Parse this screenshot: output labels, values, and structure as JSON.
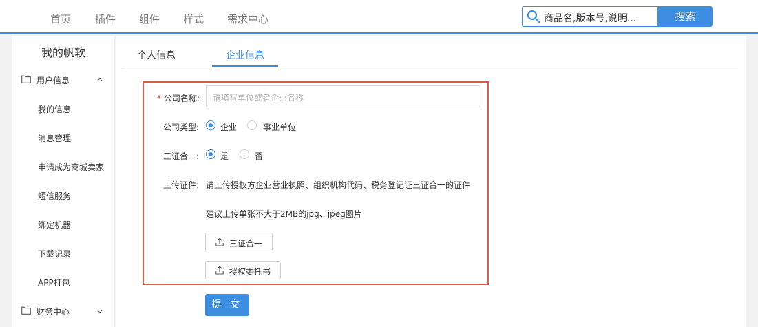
{
  "nav": {
    "items": [
      "首页",
      "插件",
      "组件",
      "样式",
      "需求中心"
    ],
    "search_placeholder": "商品名,版本号,说明...",
    "search_button": "搜索"
  },
  "sidebar": {
    "title": "我的帆软",
    "groups": [
      {
        "label": "用户信息",
        "expanded": true,
        "items": [
          "我的信息",
          "消息管理",
          "申请成为商城卖家",
          "短信服务",
          "绑定机器",
          "下载记录",
          "APP打包"
        ]
      },
      {
        "label": "财务中心",
        "expanded": false,
        "items": []
      }
    ]
  },
  "tabs": [
    {
      "label": "个人信息",
      "active": false
    },
    {
      "label": "企业信息",
      "active": true
    }
  ],
  "form": {
    "company_name_label": "公司名称:",
    "company_name_placeholder": "请填写单位或者企业名称",
    "company_type_label": "公司类型:",
    "company_type_options": [
      "企业",
      "事业单位"
    ],
    "company_type_selected": "企业",
    "three_in_one_label": "三证合一:",
    "three_in_one_options": [
      "是",
      "否"
    ],
    "three_in_one_selected": "是",
    "upload_label": "上传证件:",
    "upload_hint": "请上传授权方企业营业执照、组织机构代码、税务登记证三证合一的证件",
    "upload_size_hint": "建议上传单张不大于2MB的jpg、jpeg图片",
    "upload_buttons": [
      "三证合一",
      "授权委托书"
    ],
    "submit": "提 交"
  },
  "colors": {
    "accent": "#3d8ee0",
    "highlight_frame": "#e05a48",
    "required_mark": "#e0403a"
  },
  "icons": [
    "search-icon",
    "folder-icon",
    "chevron-up-icon",
    "chevron-down-icon",
    "upload-icon"
  ]
}
